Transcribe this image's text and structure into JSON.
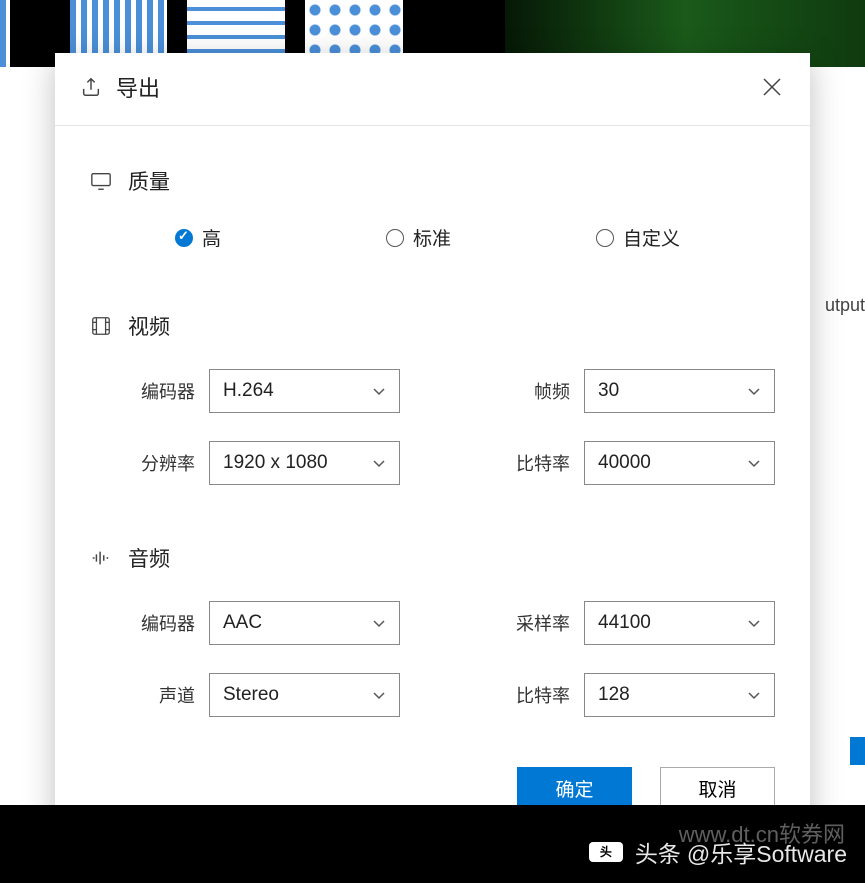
{
  "header": {
    "title": "导出"
  },
  "quality": {
    "label": "质量",
    "options": {
      "high": "高",
      "standard": "标准",
      "custom": "自定义"
    },
    "selected": "high"
  },
  "video": {
    "label": "视频",
    "encoder": {
      "label": "编码器",
      "value": "H.264"
    },
    "framerate": {
      "label": "帧频",
      "value": "30"
    },
    "resolution": {
      "label": "分辨率",
      "value": "1920 x 1080"
    },
    "bitrate": {
      "label": "比特率",
      "value": "40000"
    }
  },
  "audio": {
    "label": "音频",
    "encoder": {
      "label": "编码器",
      "value": "AAC"
    },
    "samplerate": {
      "label": "采样率",
      "value": "44100"
    },
    "channels": {
      "label": "声道",
      "value": "Stereo"
    },
    "bitrate": {
      "label": "比特率",
      "value": "128"
    }
  },
  "footer": {
    "ok": "确定",
    "cancel": "取消"
  },
  "background": {
    "output": "utput",
    "watermark": "头条",
    "attr": "@乐享Software",
    "wm2": "www.dt.cn软券网"
  }
}
